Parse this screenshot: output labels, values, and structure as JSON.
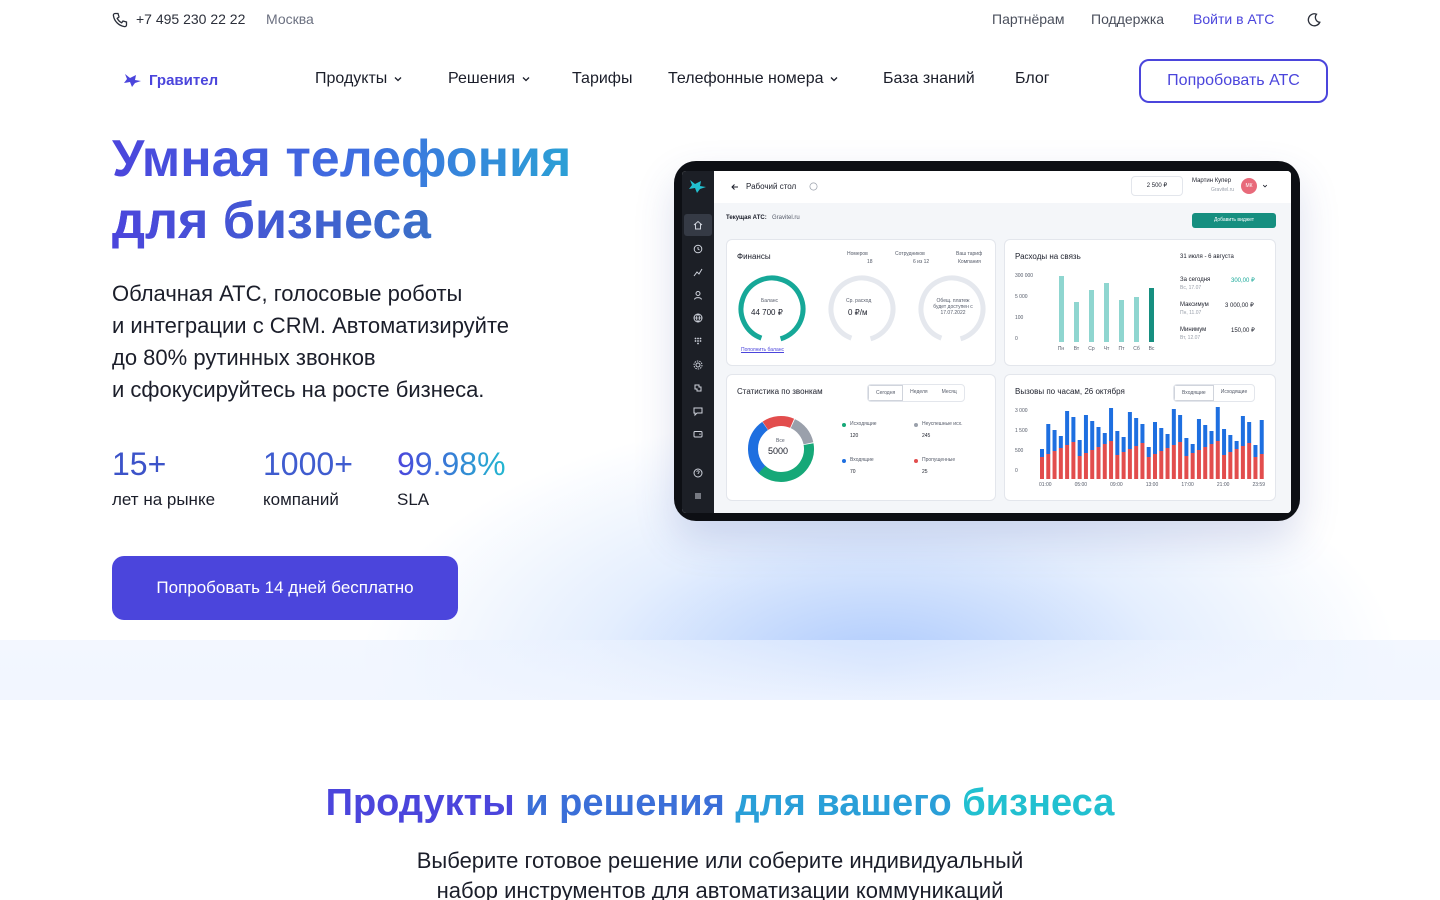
{
  "topbar": {
    "phone": "+7 495 230 22 22",
    "city": "Москва",
    "partners": "Партнёрам",
    "support": "Поддержка",
    "login": "Войти в АТС"
  },
  "nav": {
    "logo": "Гравител",
    "items": [
      "Продукты",
      "Решения",
      "Тарифы",
      "Телефонные номера",
      "База знаний",
      "Блог"
    ],
    "try_button": "Попробовать АТС"
  },
  "hero": {
    "title_line1": "Умная телефония",
    "title_line2": "для бизнеса",
    "subtitle": [
      "Облачная АТС, голосовые роботы",
      "и интеграции с CRM. Автоматизируйте",
      "до 80% рутинных звонков",
      "и сфокусируйтесь на росте бизнеса."
    ],
    "stats": [
      {
        "value": "15+",
        "label": "лет на рынке"
      },
      {
        "value": "1000+",
        "label": "компаний"
      },
      {
        "value": "99.98%",
        "label": "SLA"
      }
    ],
    "cta": "Попробовать 14 дней бесплатно"
  },
  "dashboard": {
    "header_title": "Рабочий стол",
    "balance": "2 500 ₽",
    "user_name": "Мартин Купер",
    "user_sub": "Gravitel.ru",
    "avatar_initials": "МК",
    "current_atc_label": "Текущая АТС:",
    "current_atc_value": "Gravitel.ru",
    "add_widget": "Добавить виджет",
    "finance": {
      "title": "Финансы",
      "numbers_label": "Номеров",
      "numbers_value": "18",
      "employees_label": "Сотрудников",
      "employees_value": "6 из 12",
      "tariff_label": "Ваш тариф",
      "tariff_value": "Компания",
      "balance_label": "Баланс",
      "balance_value": "44 700 ₽",
      "avg_label": "Ср. расход",
      "avg_value": "0 ₽/м",
      "payment_label": "Обещ. платеж будет доступен с 17.07.2022",
      "topup": "Пополнить баланс"
    },
    "expenses": {
      "title": "Расходы на связь",
      "period": "31 июля - 6 августа",
      "y_ticks": [
        "300 000",
        "5 000",
        "100",
        "0"
      ],
      "days": [
        "Пн",
        "Вт",
        "Ср",
        "Чт",
        "Пт",
        "Сб",
        "Вс"
      ],
      "rows": [
        {
          "label": "За сегодня",
          "sub": "Вс, 17.07",
          "value": "300,00 ₽"
        },
        {
          "label": "Максимум",
          "sub": "Пн, 11.07",
          "value": "3 000,00 ₽"
        },
        {
          "label": "Минимум",
          "sub": "Вт, 12.07",
          "value": "150,00 ₽"
        }
      ]
    },
    "call_stats": {
      "title": "Статистика по звонкам",
      "tabs": [
        "Сегодня",
        "Неделя",
        "Месяц"
      ],
      "center_label": "Все",
      "center_value": "5000",
      "items": [
        {
          "label": "Исходящие",
          "value": "120",
          "color": "#16a878"
        },
        {
          "label": "Неуспешные исх.",
          "value": "245",
          "color": "#9aa0ab"
        },
        {
          "label": "Входящие",
          "value": "70",
          "color": "#1e6fe0"
        },
        {
          "label": "Пропущенные",
          "value": "25",
          "color": "#e24d4d"
        }
      ]
    },
    "hourly": {
      "title": "Вызовы по часам, 26 октября",
      "tabs": [
        "Входящие",
        "Исходящие"
      ],
      "y_ticks": [
        "3 000",
        "1 500",
        "500",
        "0"
      ],
      "x_ticks": [
        "01:00",
        "05:00",
        "09:00",
        "13:00",
        "17:00",
        "21:00",
        "23:59"
      ]
    }
  },
  "products": {
    "title_a": "Продукты",
    "title_b": "и решения",
    "title_c": "для вашего",
    "title_d": "бизнеса",
    "subtitle_1": "Выберите готовое решение или соберите индивидуальный",
    "subtitle_2": "набор инструментов для автоматизации коммуникаций"
  },
  "colors": {
    "brand": "#4b45dc",
    "teal": "#16a898",
    "blue_bar": "#1e6fe0",
    "red_bar": "#e24d4d"
  }
}
